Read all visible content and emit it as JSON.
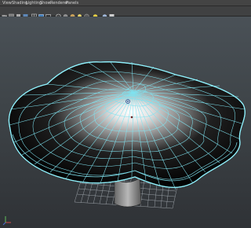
{
  "menu": [
    "View",
    "Shading",
    "Lighting",
    "Show",
    "Renderer",
    "Panels"
  ],
  "toolbar": {
    "icons": [
      "camera-icon",
      "camera-attributes-icon",
      "bookmark-icon",
      "image-plane-icon",
      "grid-icon",
      "film-gate-icon",
      "resolution-gate-icon",
      "wireframe-icon",
      "smooth-shade-icon",
      "textured-icon",
      "lights-icon",
      "shadows-icon",
      "isolate-icon",
      "xray-icon",
      "backface-icon"
    ]
  },
  "viewport": {
    "background_top": "#4a5157",
    "background_bottom": "#2f3236",
    "wireframe_color": "#7fe3f0",
    "ground_grid_color": "#9aa0a6"
  },
  "axis": {
    "x_label": "x",
    "y_label": "y",
    "z_label": "z",
    "x_color": "#d24a4a",
    "y_color": "#5fbf5a",
    "z_color": "#4a6fd2"
  }
}
